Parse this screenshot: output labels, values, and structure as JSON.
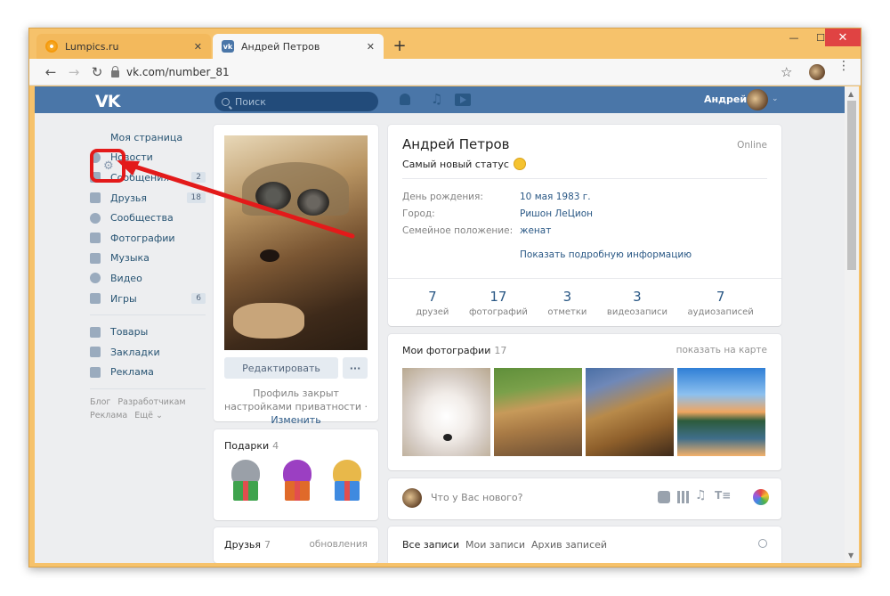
{
  "browser": {
    "tabs": [
      {
        "title": "Lumpics.ru",
        "active": false
      },
      {
        "title": "Андрей Петров",
        "active": true
      }
    ],
    "new_tab": "+",
    "url": "vk.com/number_81",
    "controls": {
      "minimize": "—",
      "maximize": "☐",
      "close": "✕"
    },
    "tab_close": "✕",
    "back": "←",
    "forward": "→",
    "reload": "↻",
    "star": "☆",
    "menu": "⋮"
  },
  "vk_header": {
    "logo": "VK",
    "search_placeholder": "Поиск",
    "user_name": "Андрей",
    "chevron": "⌄",
    "music_glyph": "♫"
  },
  "left_nav": {
    "items": [
      {
        "label": "Моя страница",
        "count": null,
        "icon": "home-icon"
      },
      {
        "label": "Новости",
        "count": null,
        "icon": "news-icon"
      },
      {
        "label": "Сообщения",
        "count": "2",
        "icon": "messages-icon"
      },
      {
        "label": "Друзья",
        "count": "18",
        "icon": "friends-icon"
      },
      {
        "label": "Сообщества",
        "count": null,
        "icon": "groups-icon"
      },
      {
        "label": "Фотографии",
        "count": null,
        "icon": "photos-icon"
      },
      {
        "label": "Музыка",
        "count": null,
        "icon": "music-icon"
      },
      {
        "label": "Видео",
        "count": null,
        "icon": "video-icon"
      },
      {
        "label": "Игры",
        "count": "6",
        "icon": "games-icon"
      }
    ],
    "items2": [
      {
        "label": "Товары",
        "icon": "goods-icon"
      },
      {
        "label": "Закладки",
        "icon": "bookmarks-icon"
      },
      {
        "label": "Реклама",
        "icon": "ads-icon"
      }
    ],
    "footer": [
      "Блог",
      "Разработчикам",
      "Реклама",
      "Ещё ⌄"
    ],
    "gear_glyph": "⚙"
  },
  "profile": {
    "edit_label": "Редактировать",
    "more_label": "···",
    "privacy_text": "Профиль закрыт настройками приватности ·",
    "privacy_link": "Изменить",
    "name": "Андрей Петров",
    "online": "Online",
    "status": "Самый новый статус",
    "info": [
      {
        "key": "День рождения:",
        "value": "10 мая 1983 г."
      },
      {
        "key": "Город:",
        "value": "Ришон ЛеЦион"
      },
      {
        "key": "Семейное положение:",
        "value": "женат"
      }
    ],
    "more_info": "Показать подробную информацию",
    "counters": [
      {
        "num": "7",
        "label": "друзей"
      },
      {
        "num": "17",
        "label": "фотографий"
      },
      {
        "num": "3",
        "label": "отметки"
      },
      {
        "num": "3",
        "label": "видеозаписи"
      },
      {
        "num": "7",
        "label": "аудиозаписей"
      }
    ]
  },
  "gifts": {
    "title": "Подарки",
    "count": "4"
  },
  "friends": {
    "title": "Друзья",
    "count": "7",
    "updates": "обновления"
  },
  "photos": {
    "title": "Мои фотографии",
    "count": "17",
    "map_link": "показать на карте"
  },
  "wall": {
    "placeholder": "Что у Вас нового?",
    "music_glyph": "♫",
    "text_glyph": "T≡"
  },
  "posts_tabs": [
    "Все записи",
    "Мои записи",
    "Архив записей"
  ],
  "colors": {
    "vk_blue": "#4a76a8",
    "highlight_red": "#e31a1a",
    "browser_frame": "#f6c26b"
  }
}
